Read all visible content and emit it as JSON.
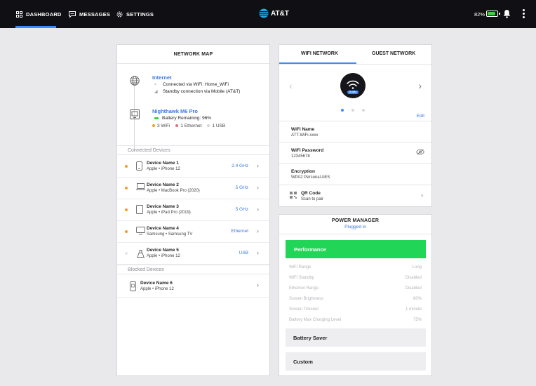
{
  "topbar": {
    "nav": [
      {
        "label": "DASHBOARD"
      },
      {
        "label": "MESSAGES"
      },
      {
        "label": "SETTINGS"
      }
    ],
    "brand": "AT&T",
    "battery_percent": "82%",
    "battery_level": 0.82,
    "colors": {
      "background": "#101014",
      "accent": "#3d8bfd",
      "battery": "#45c943"
    }
  },
  "network_map": {
    "title": "NETWORK MAP",
    "internet": {
      "title": "Internet",
      "line1": "Connected via WiFi: Home_WiFi",
      "line2": "Standby connection via Mobile (AT&T)"
    },
    "hub": {
      "title": "Nighthawk M6 Pro",
      "battery": "Battery Remaining: 96%",
      "ports": [
        {
          "label": "3 WiFi",
          "color": "#f39c2b"
        },
        {
          "label": "1 Ethernet",
          "color": "#ef6b6b"
        },
        {
          "label": "1 USB",
          "color": "#d5d5d9"
        }
      ]
    },
    "connected_label": "Connected Devices",
    "devices": [
      {
        "name": "Device Name 1",
        "sub": "Apple • iPhone 12",
        "band": "2.4 GHz",
        "icon": "phone-icon",
        "status_color": "#f39c2b"
      },
      {
        "name": "Device Name 2",
        "sub": "Apple • MacBook Pro (2020)",
        "band": "5 GHz",
        "icon": "laptop-icon",
        "status_color": "#f39c2b"
      },
      {
        "name": "Device Name 3",
        "sub": "Apple • iPad Pro (2019)",
        "band": "5 GHz",
        "icon": "tablet-icon",
        "status_color": "#f39c2b"
      },
      {
        "name": "Device Name 4",
        "sub": "Samsung • Samsung TV",
        "band": "Ethernet",
        "icon": "tv-icon",
        "status_color": "#f39c2b"
      },
      {
        "name": "Device Name 5",
        "sub": "Apple • iPhone 12",
        "band": "USB",
        "icon": "usb-phone-icon",
        "status_color": "#d9d9dd"
      }
    ],
    "blocked_label": "Blocked Devices",
    "blocked": [
      {
        "name": "Device Name 6",
        "sub": "Apple • iPhone 12",
        "icon": "blocked-phone-icon"
      }
    ]
  },
  "wifi": {
    "tabs": [
      "WIFI NETWORK",
      "GUEST NETWORK"
    ],
    "band_badge": "5 GHz",
    "edit": "Edit",
    "fields": [
      {
        "label": "WiFi Name",
        "value": "ATT-WiFi-xxxx"
      },
      {
        "label": "WiFi Password",
        "value": "12345678"
      },
      {
        "label": "Encryption",
        "value": "WPA2 Personal AES"
      }
    ],
    "qr": {
      "label": "QR Code",
      "value": "Scan to pair"
    }
  },
  "power": {
    "title": "POWER MANAGER",
    "status": "Plugged in",
    "active_mode": "Performance",
    "active_color": "#21d656",
    "settings": [
      {
        "label": "WiFi Range",
        "value": "Long"
      },
      {
        "label": "WiFi Standby",
        "value": "Disabled"
      },
      {
        "label": "Ethernet Range",
        "value": "Disabled"
      },
      {
        "label": "Screen Brightness",
        "value": "60%"
      },
      {
        "label": "Screen Timeout",
        "value": "1 minute"
      },
      {
        "label": "Battery Max Charging Level",
        "value": "75%"
      }
    ],
    "other_modes": [
      "Battery Saver",
      "Custom"
    ]
  }
}
